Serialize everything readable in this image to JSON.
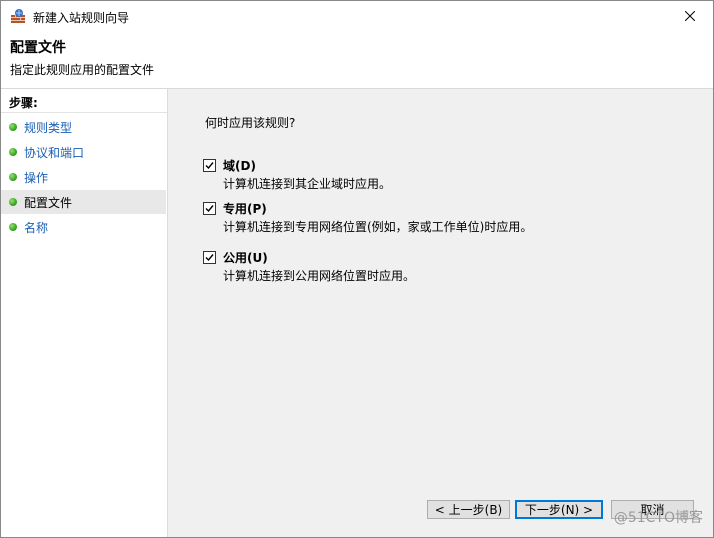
{
  "window": {
    "title": "新建入站规则向导"
  },
  "header": {
    "title": "配置文件",
    "subtitle": "指定此规则应用的配置文件"
  },
  "sidebar": {
    "title": "步骤:",
    "items": [
      {
        "label": "规则类型"
      },
      {
        "label": "协议和端口"
      },
      {
        "label": "操作"
      },
      {
        "label": "配置文件"
      },
      {
        "label": "名称"
      }
    ],
    "active_index": 3
  },
  "main": {
    "question": "何时应用该规则?",
    "options": [
      {
        "label": "域(D)",
        "description": "计算机连接到其企业域时应用。",
        "checked": true
      },
      {
        "label": "专用(P)",
        "description": "计算机连接到专用网络位置(例如，家或工作单位)时应用。",
        "checked": true
      },
      {
        "label": "公用(U)",
        "description": "计算机连接到公用网络位置时应用。",
        "checked": true
      }
    ]
  },
  "buttons": {
    "back": "< 上一步(B)",
    "next": "下一步(N) >",
    "cancel": "取消"
  },
  "watermark": "@51CTO博客",
  "colors": {
    "link": "#1a5fb4",
    "active_step_bg": "#e8e8e8",
    "accent": "#0078d7"
  }
}
